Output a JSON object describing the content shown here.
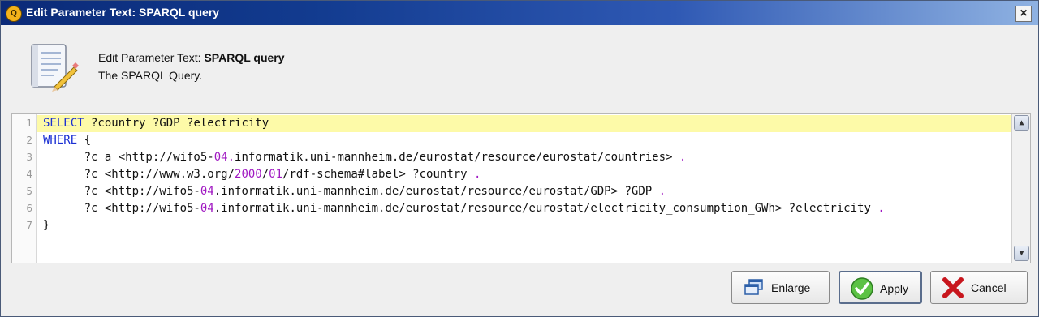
{
  "window": {
    "title": "Edit Parameter Text: SPARQL query",
    "app_icon_glyph": "Q",
    "close_glyph": "×"
  },
  "header": {
    "prefix": "Edit Parameter Text: ",
    "param_name": "SPARQL query",
    "description": "The SPARQL Query.",
    "icon": "notepad-pencil-icon"
  },
  "editor": {
    "line_numbers": [
      "1",
      "2",
      "3",
      "4",
      "5",
      "6",
      "7"
    ],
    "lines": [
      [
        {
          "t": "SELECT",
          "c": "kw"
        },
        {
          "t": " ?country ?GDP ?electricity",
          "c": ""
        }
      ],
      [
        {
          "t": "WHERE",
          "c": "kw"
        },
        {
          "t": " {",
          "c": ""
        }
      ],
      [
        {
          "t": "      ?c a <http://wifo5-",
          "c": ""
        },
        {
          "t": "04.",
          "c": "num-lit"
        },
        {
          "t": "informatik.uni-mannheim.de/eurostat/resource/eurostat/countries> ",
          "c": ""
        },
        {
          "t": ".",
          "c": "dot"
        }
      ],
      [
        {
          "t": "      ?c <http://www.w3.org/",
          "c": ""
        },
        {
          "t": "2000",
          "c": "num-lit"
        },
        {
          "t": "/",
          "c": ""
        },
        {
          "t": "01",
          "c": "num-lit"
        },
        {
          "t": "/rdf-schema#label> ?country ",
          "c": ""
        },
        {
          "t": ".",
          "c": "dot"
        }
      ],
      [
        {
          "t": "      ?c <http://wifo5-",
          "c": ""
        },
        {
          "t": "04",
          "c": "num-lit"
        },
        {
          "t": ".informatik.uni-mannheim.de/eurostat/resource/eurostat/GDP> ?GDP ",
          "c": ""
        },
        {
          "t": ".",
          "c": "dot"
        }
      ],
      [
        {
          "t": "      ?c <http://wifo5-",
          "c": ""
        },
        {
          "t": "04",
          "c": "num-lit"
        },
        {
          "t": ".informatik.uni-mannheim.de/eurostat/resource/eurostat/electricity_consumption_GWh> ?electricity ",
          "c": ""
        },
        {
          "t": ".",
          "c": "dot"
        }
      ],
      [
        {
          "t": "}",
          "c": ""
        }
      ]
    ],
    "highlighted_line": 1
  },
  "buttons": {
    "enlarge": {
      "pre": "Enla",
      "mnemonic": "r",
      "post": "ge",
      "icon": "windows-icon"
    },
    "apply": {
      "pre": "",
      "mnemonic": "",
      "post": "Apply",
      "icon": "checkmark-icon"
    },
    "cancel": {
      "pre": "",
      "mnemonic": "C",
      "post": "ancel",
      "icon": "red-x-icon"
    }
  },
  "colors": {
    "keyword": "#1a2fd3",
    "number": "#a018c2",
    "highlight": "#fdfaa8",
    "titlebar": "#0b2a78"
  }
}
